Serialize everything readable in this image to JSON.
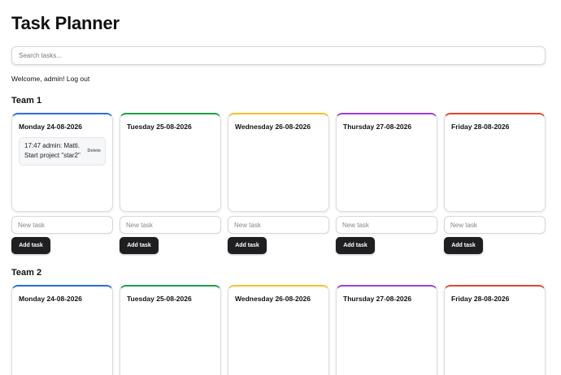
{
  "header": {
    "title": "Task Planner"
  },
  "search": {
    "placeholder": "Search tasks..."
  },
  "welcome": {
    "text": "Welcome, admin!",
    "logout_label": "Log out"
  },
  "colors": {
    "monday": "#2a6fdb",
    "tuesday": "#1e9e4a",
    "wednesday": "#f2c12e",
    "thursday": "#9b3fd6",
    "friday": "#e0452f"
  },
  "teams": [
    {
      "name": "Team 1",
      "days": [
        {
          "title": "Monday 24-08-2026",
          "tasks": [
            {
              "text": "17:47 admin: Matti. Start project \"star2\"",
              "delete_label": "Delete"
            }
          ],
          "new_task_placeholder": "New task",
          "add_label": "Add task"
        },
        {
          "title": "Tuesday 25-08-2026",
          "tasks": [],
          "new_task_placeholder": "New task",
          "add_label": "Add task"
        },
        {
          "title": "Wednesday 26-08-2026",
          "tasks": [],
          "new_task_placeholder": "New task",
          "add_label": "Add task"
        },
        {
          "title": "Thursday 27-08-2026",
          "tasks": [],
          "new_task_placeholder": "New task",
          "add_label": "Add task"
        },
        {
          "title": "Friday 28-08-2026",
          "tasks": [],
          "new_task_placeholder": "New task",
          "add_label": "Add task"
        }
      ]
    },
    {
      "name": "Team 2",
      "days": [
        {
          "title": "Monday 24-08-2026"
        },
        {
          "title": "Tuesday 25-08-2026"
        },
        {
          "title": "Wednesday 26-08-2026"
        },
        {
          "title": "Thursday 27-08-2026"
        },
        {
          "title": "Friday 28-08-2026"
        }
      ]
    }
  ]
}
